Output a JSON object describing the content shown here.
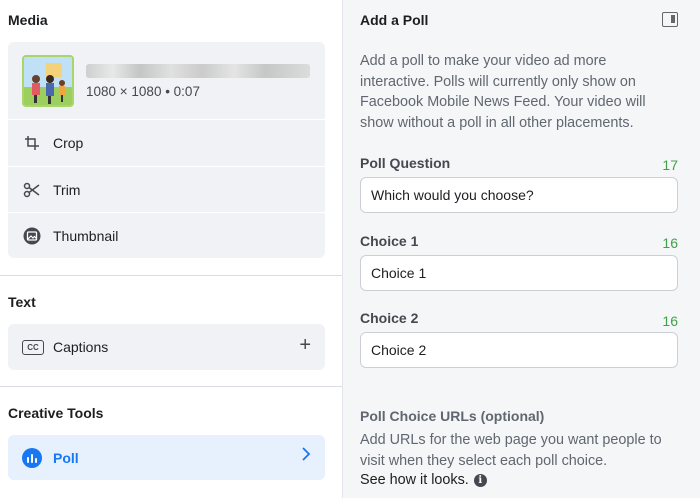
{
  "media": {
    "title": "Media",
    "dimensions": "1080 × 1080 • 0:07",
    "actions": [
      {
        "label": "Crop",
        "icon": "crop-icon"
      },
      {
        "label": "Trim",
        "icon": "scissors-icon"
      },
      {
        "label": "Thumbnail",
        "icon": "thumbnail-icon"
      }
    ]
  },
  "text_section": {
    "title": "Text",
    "captions_label": "Captions",
    "captions_icon_text": "CC"
  },
  "creative_tools": {
    "title": "Creative Tools",
    "poll_label": "Poll"
  },
  "poll_panel": {
    "title": "Add a Poll",
    "description": "Add a poll to make your video ad more interactive. Polls will currently only show on Facebook Mobile News Feed. Your video will show without a poll in all other placements.",
    "question": {
      "label": "Poll Question",
      "count": "17",
      "value": "Which would you choose?"
    },
    "choice1": {
      "label": "Choice 1",
      "count": "16",
      "value": "Choice 1"
    },
    "choice2": {
      "label": "Choice 2",
      "count": "16",
      "value": "Choice 2"
    },
    "urls_title": "Poll Choice URLs (optional)",
    "urls_description": "Add URLs for the web page you want people to visit when they select each poll choice.",
    "see_how": "See how it looks."
  },
  "colors": {
    "accent": "#1877f2",
    "count_green": "#42a148",
    "card_bg": "#f0f2f5",
    "panel_bg": "#f5f6f7"
  }
}
